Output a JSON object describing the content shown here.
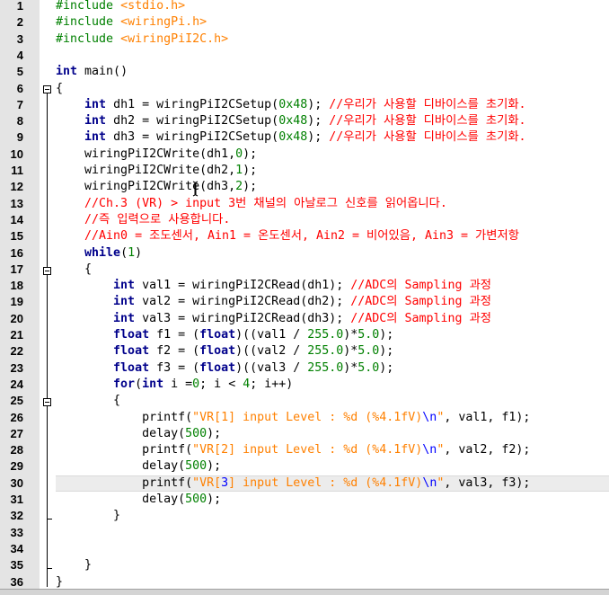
{
  "editor": {
    "active_line": 30,
    "lines": [
      {
        "n": "1",
        "tokens": [
          {
            "c": "pp",
            "t": "#include "
          },
          {
            "c": "inc",
            "t": "<stdio.h>"
          }
        ]
      },
      {
        "n": "2",
        "tokens": [
          {
            "c": "pp",
            "t": "#include "
          },
          {
            "c": "inc",
            "t": "<wiringPi.h>"
          }
        ]
      },
      {
        "n": "3",
        "tokens": [
          {
            "c": "pp",
            "t": "#include "
          },
          {
            "c": "inc",
            "t": "<wiringPiI2C.h>"
          }
        ]
      },
      {
        "n": "4",
        "tokens": []
      },
      {
        "n": "5",
        "tokens": [
          {
            "c": "kw",
            "t": "int"
          },
          {
            "c": "txt",
            "t": " main()"
          }
        ]
      },
      {
        "n": "6",
        "tokens": [
          {
            "c": "txt",
            "t": "{"
          }
        ]
      },
      {
        "n": "7",
        "tokens": [
          {
            "c": "txt",
            "t": "    "
          },
          {
            "c": "kw",
            "t": "int"
          },
          {
            "c": "txt",
            "t": " dh1 = wiringPiI2CSetup("
          },
          {
            "c": "num",
            "t": "0x48"
          },
          {
            "c": "txt",
            "t": "); "
          },
          {
            "c": "cmt",
            "t": "//우리가 사용할 디바이스를 초기화."
          }
        ]
      },
      {
        "n": "8",
        "tokens": [
          {
            "c": "txt",
            "t": "    "
          },
          {
            "c": "kw",
            "t": "int"
          },
          {
            "c": "txt",
            "t": " dh2 = wiringPiI2CSetup("
          },
          {
            "c": "num",
            "t": "0x48"
          },
          {
            "c": "txt",
            "t": "); "
          },
          {
            "c": "cmt",
            "t": "//우리가 사용할 디바이스를 초기화."
          }
        ]
      },
      {
        "n": "9",
        "tokens": [
          {
            "c": "txt",
            "t": "    "
          },
          {
            "c": "kw",
            "t": "int"
          },
          {
            "c": "txt",
            "t": " dh3 = wiringPiI2CSetup("
          },
          {
            "c": "num",
            "t": "0x48"
          },
          {
            "c": "txt",
            "t": "); "
          },
          {
            "c": "cmt",
            "t": "//우리가 사용할 디바이스를 초기화."
          }
        ]
      },
      {
        "n": "10",
        "tokens": [
          {
            "c": "txt",
            "t": "    wiringPiI2CWrite(dh1,"
          },
          {
            "c": "num",
            "t": "0"
          },
          {
            "c": "txt",
            "t": ");"
          }
        ]
      },
      {
        "n": "11",
        "tokens": [
          {
            "c": "txt",
            "t": "    wiringPiI2CWrite(dh2,"
          },
          {
            "c": "num",
            "t": "1"
          },
          {
            "c": "txt",
            "t": ");"
          }
        ]
      },
      {
        "n": "12",
        "tokens": [
          {
            "c": "txt",
            "t": "    wiringPiI2CWrite(dh3,"
          },
          {
            "c": "num",
            "t": "2"
          },
          {
            "c": "txt",
            "t": ");"
          }
        ]
      },
      {
        "n": "13",
        "tokens": [
          {
            "c": "txt",
            "t": "    "
          },
          {
            "c": "cmt",
            "t": "//Ch.3 (VR) > input 3번 채널의 아날로그 신호를 읽어옵니다."
          }
        ]
      },
      {
        "n": "14",
        "tokens": [
          {
            "c": "txt",
            "t": "    "
          },
          {
            "c": "cmt",
            "t": "//즉 입력으로 사용합니다."
          }
        ]
      },
      {
        "n": "15",
        "tokens": [
          {
            "c": "txt",
            "t": "    "
          },
          {
            "c": "cmt",
            "t": "//Ain0 = 조도센서, Ain1 = 온도센서, Ain2 = 비어있음, Ain3 = 가변저항"
          }
        ]
      },
      {
        "n": "16",
        "tokens": [
          {
            "c": "txt",
            "t": "    "
          },
          {
            "c": "kw",
            "t": "while"
          },
          {
            "c": "txt",
            "t": "("
          },
          {
            "c": "num",
            "t": "1"
          },
          {
            "c": "txt",
            "t": ")"
          }
        ]
      },
      {
        "n": "17",
        "tokens": [
          {
            "c": "txt",
            "t": "    {"
          }
        ]
      },
      {
        "n": "18",
        "tokens": [
          {
            "c": "txt",
            "t": "        "
          },
          {
            "c": "kw",
            "t": "int"
          },
          {
            "c": "txt",
            "t": " val1 = wiringPiI2CRead(dh1); "
          },
          {
            "c": "cmt",
            "t": "//ADC의 Sampling 과정"
          }
        ]
      },
      {
        "n": "19",
        "tokens": [
          {
            "c": "txt",
            "t": "        "
          },
          {
            "c": "kw",
            "t": "int"
          },
          {
            "c": "txt",
            "t": " val2 = wiringPiI2CRead(dh2); "
          },
          {
            "c": "cmt",
            "t": "//ADC의 Sampling 과정"
          }
        ]
      },
      {
        "n": "20",
        "tokens": [
          {
            "c": "txt",
            "t": "        "
          },
          {
            "c": "kw",
            "t": "int"
          },
          {
            "c": "txt",
            "t": " val3 = wiringPiI2CRead(dh3); "
          },
          {
            "c": "cmt",
            "t": "//ADC의 Sampling 과정"
          }
        ]
      },
      {
        "n": "21",
        "tokens": [
          {
            "c": "txt",
            "t": "        "
          },
          {
            "c": "kw",
            "t": "float"
          },
          {
            "c": "txt",
            "t": " f1 = ("
          },
          {
            "c": "kw",
            "t": "float"
          },
          {
            "c": "txt",
            "t": ")((val1 / "
          },
          {
            "c": "num",
            "t": "255.0"
          },
          {
            "c": "txt",
            "t": ")*"
          },
          {
            "c": "num",
            "t": "5.0"
          },
          {
            "c": "txt",
            "t": ");"
          }
        ]
      },
      {
        "n": "22",
        "tokens": [
          {
            "c": "txt",
            "t": "        "
          },
          {
            "c": "kw",
            "t": "float"
          },
          {
            "c": "txt",
            "t": " f2 = ("
          },
          {
            "c": "kw",
            "t": "float"
          },
          {
            "c": "txt",
            "t": ")((val2 / "
          },
          {
            "c": "num",
            "t": "255.0"
          },
          {
            "c": "txt",
            "t": ")*"
          },
          {
            "c": "num",
            "t": "5.0"
          },
          {
            "c": "txt",
            "t": ");"
          }
        ]
      },
      {
        "n": "23",
        "tokens": [
          {
            "c": "txt",
            "t": "        "
          },
          {
            "c": "kw",
            "t": "float"
          },
          {
            "c": "txt",
            "t": " f3 = ("
          },
          {
            "c": "kw",
            "t": "float"
          },
          {
            "c": "txt",
            "t": ")((val3 / "
          },
          {
            "c": "num",
            "t": "255.0"
          },
          {
            "c": "txt",
            "t": ")*"
          },
          {
            "c": "num",
            "t": "5.0"
          },
          {
            "c": "txt",
            "t": ");"
          }
        ]
      },
      {
        "n": "24",
        "tokens": [
          {
            "c": "txt",
            "t": "        "
          },
          {
            "c": "kw",
            "t": "for"
          },
          {
            "c": "txt",
            "t": "("
          },
          {
            "c": "kw",
            "t": "int"
          },
          {
            "c": "txt",
            "t": " i ="
          },
          {
            "c": "num",
            "t": "0"
          },
          {
            "c": "txt",
            "t": "; i < "
          },
          {
            "c": "num",
            "t": "4"
          },
          {
            "c": "txt",
            "t": "; i++)"
          }
        ]
      },
      {
        "n": "25",
        "tokens": [
          {
            "c": "txt",
            "t": "        {"
          }
        ]
      },
      {
        "n": "26",
        "tokens": [
          {
            "c": "txt",
            "t": "            printf("
          },
          {
            "c": "str",
            "t": "\"VR[1] input Level : %d (%4.1fV)"
          },
          {
            "c": "esc",
            "t": "\\n"
          },
          {
            "c": "str",
            "t": "\""
          },
          {
            "c": "txt",
            "t": ", val1, f1);"
          }
        ]
      },
      {
        "n": "27",
        "tokens": [
          {
            "c": "txt",
            "t": "            delay("
          },
          {
            "c": "num",
            "t": "500"
          },
          {
            "c": "txt",
            "t": ");"
          }
        ]
      },
      {
        "n": "28",
        "tokens": [
          {
            "c": "txt",
            "t": "            printf("
          },
          {
            "c": "str",
            "t": "\"VR[2] input Level : %d (%4.1fV)"
          },
          {
            "c": "esc",
            "t": "\\n"
          },
          {
            "c": "str",
            "t": "\""
          },
          {
            "c": "txt",
            "t": ", val2, f2);"
          }
        ]
      },
      {
        "n": "29",
        "tokens": [
          {
            "c": "txt",
            "t": "            delay("
          },
          {
            "c": "num",
            "t": "500"
          },
          {
            "c": "txt",
            "t": ");"
          }
        ]
      },
      {
        "n": "30",
        "tokens": [
          {
            "c": "txt",
            "t": "            printf("
          },
          {
            "c": "str",
            "t": "\"VR["
          },
          {
            "c": "esc",
            "t": "3"
          },
          {
            "c": "str",
            "t": "] input Level : %d (%4.1fV)"
          },
          {
            "c": "esc",
            "t": "\\n"
          },
          {
            "c": "str",
            "t": "\""
          },
          {
            "c": "txt",
            "t": ", val3, f3);"
          }
        ]
      },
      {
        "n": "31",
        "tokens": [
          {
            "c": "txt",
            "t": "            delay("
          },
          {
            "c": "num",
            "t": "500"
          },
          {
            "c": "txt",
            "t": ");"
          }
        ]
      },
      {
        "n": "32",
        "tokens": [
          {
            "c": "txt",
            "t": "        }"
          }
        ]
      },
      {
        "n": "33",
        "tokens": []
      },
      {
        "n": "34",
        "tokens": []
      },
      {
        "n": "35",
        "tokens": [
          {
            "c": "txt",
            "t": "    }"
          }
        ]
      },
      {
        "n": "36",
        "tokens": [
          {
            "c": "txt",
            "t": "}"
          }
        ]
      }
    ]
  },
  "colors": {
    "keyword": "#00008b",
    "preprocessor": "#008000",
    "include_path": "#ff8000",
    "number": "#008000",
    "string": "#ff8000",
    "escape": "#0000ff",
    "comment": "#ff0000",
    "gutter_bg": "#e4e4e4",
    "active_line_bg": "#ececec"
  }
}
